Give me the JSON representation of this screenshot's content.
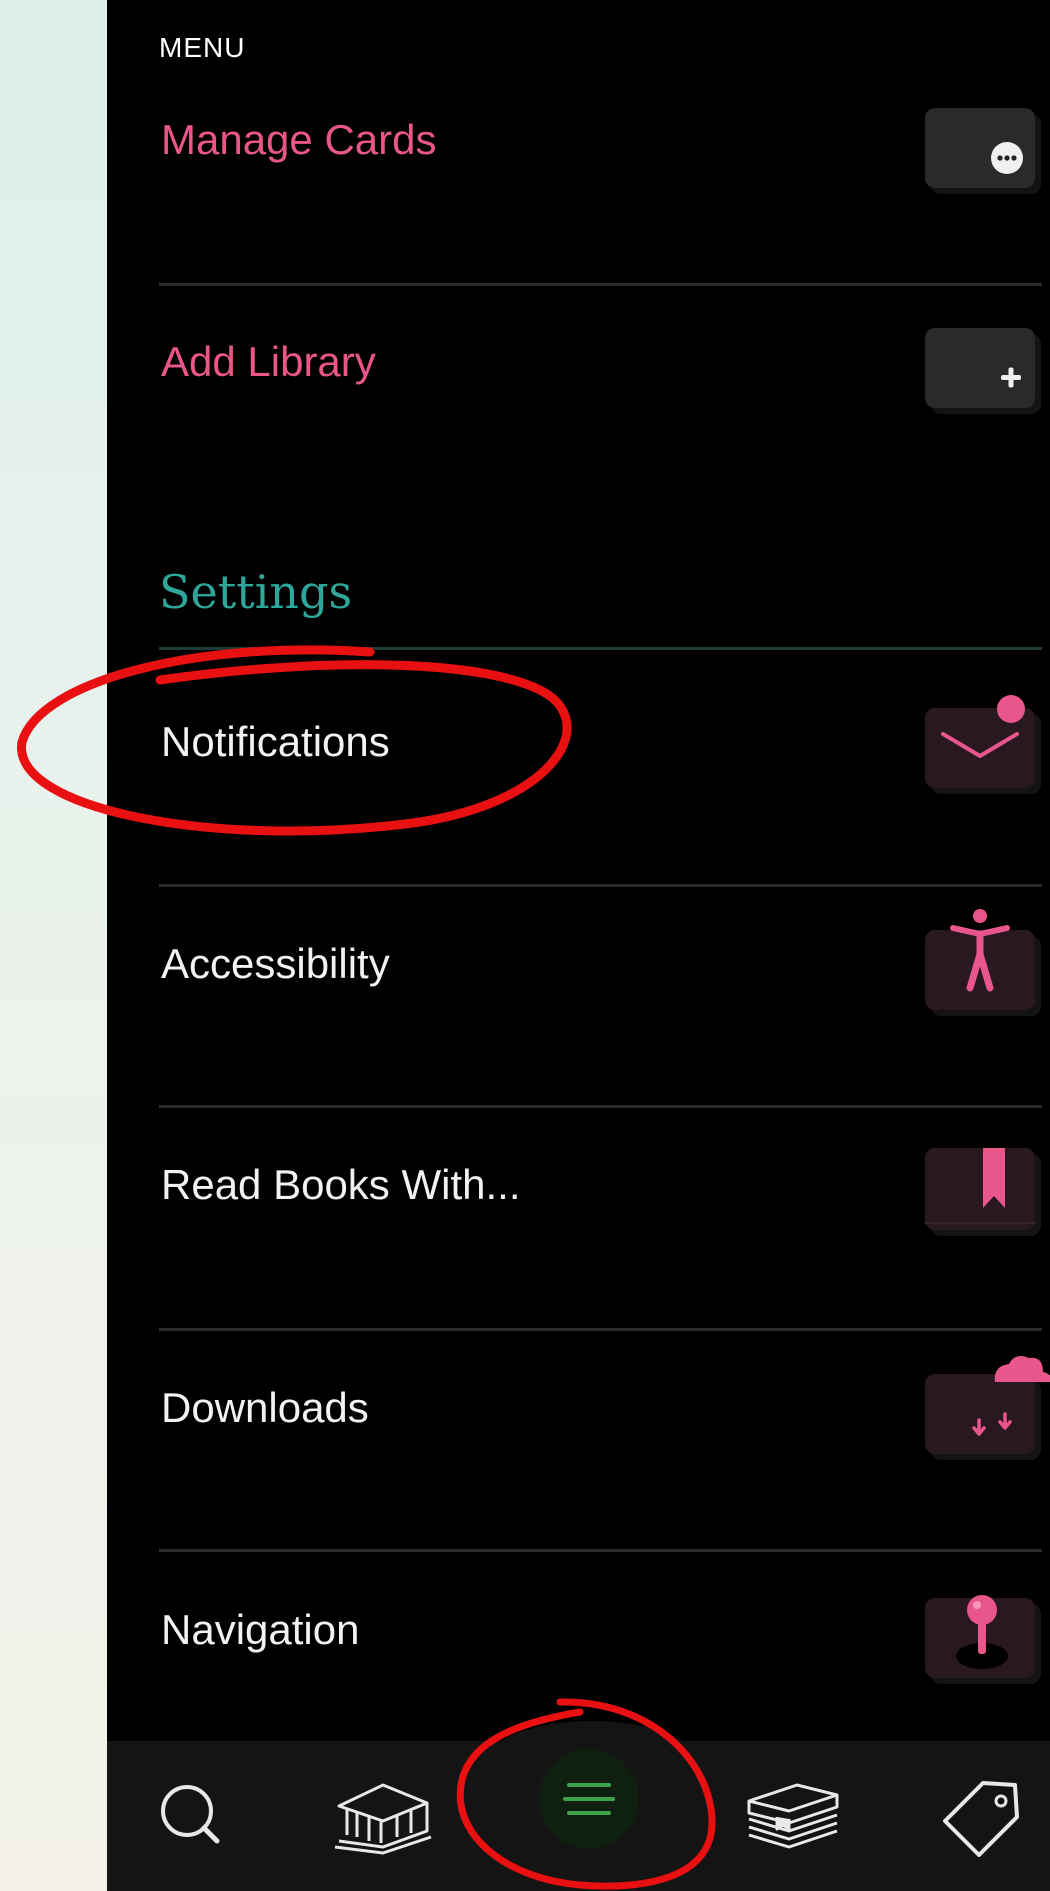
{
  "menu": {
    "title": "MENU",
    "items_top": [
      {
        "label": "Manage Cards",
        "icon": "more-dots-icon"
      },
      {
        "label": "Add Library",
        "icon": "plus-icon"
      }
    ],
    "settings_title": "Settings",
    "settings_items": [
      {
        "label": "Notifications",
        "icon": "envelope-icon",
        "has_badge": true
      },
      {
        "label": "Accessibility",
        "icon": "accessibility-icon"
      },
      {
        "label": "Read Books With...",
        "icon": "bookmark-book-icon"
      },
      {
        "label": "Downloads",
        "icon": "cloud-download-icon"
      },
      {
        "label": "Navigation",
        "icon": "joystick-icon"
      }
    ]
  },
  "tabbar": {
    "tabs": [
      {
        "icon": "search-icon"
      },
      {
        "icon": "library-building-icon"
      },
      {
        "icon": "menu-icon",
        "active": true
      },
      {
        "icon": "books-stack-icon"
      },
      {
        "icon": "tag-icon"
      }
    ]
  },
  "colors": {
    "accent_pink": "#e9568c",
    "accent_teal": "#2ea79a",
    "active_green": "#3fa34d",
    "annotation_red": "#e81010"
  }
}
